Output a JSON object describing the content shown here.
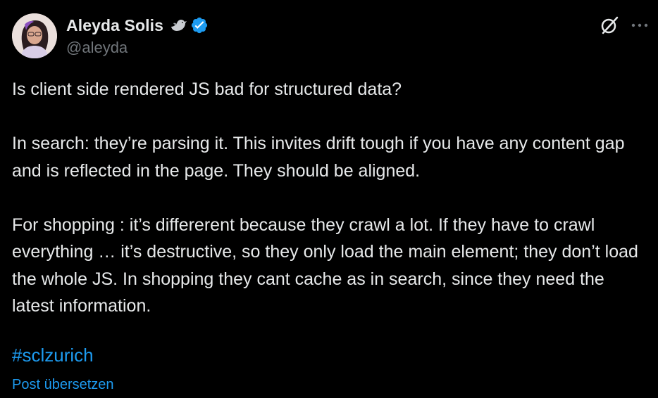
{
  "author": {
    "display_name": "Aleyda Solis",
    "handle": "@aleyda",
    "badge_icon": "bird-icon",
    "verified_icon": "verified-badge-icon",
    "avatar": "profile-avatar"
  },
  "tweet": {
    "text": "Is client side rendered JS bad for structured data?\n\nIn search: they’re parsing it. This invites drift tough if you have any content gap and is reflected in the page. They should be aligned.\n\nFor shopping : it’s differerent because they crawl a lot. If they have to crawl everything … it’s destructive, so they only load the main element; they don’t load the whole JS. In shopping they cant cache as in search, since they need the latest information.",
    "hashtag": "#sclzurich",
    "translate_label": "Post übersetzen"
  },
  "actions": {
    "grok_icon": "grok-icon",
    "more_icon": "more-options-icon"
  },
  "colors": {
    "background": "#000000",
    "text": "#e7e9ea",
    "secondary_text": "#71767b",
    "accent": "#1d9bf0"
  }
}
